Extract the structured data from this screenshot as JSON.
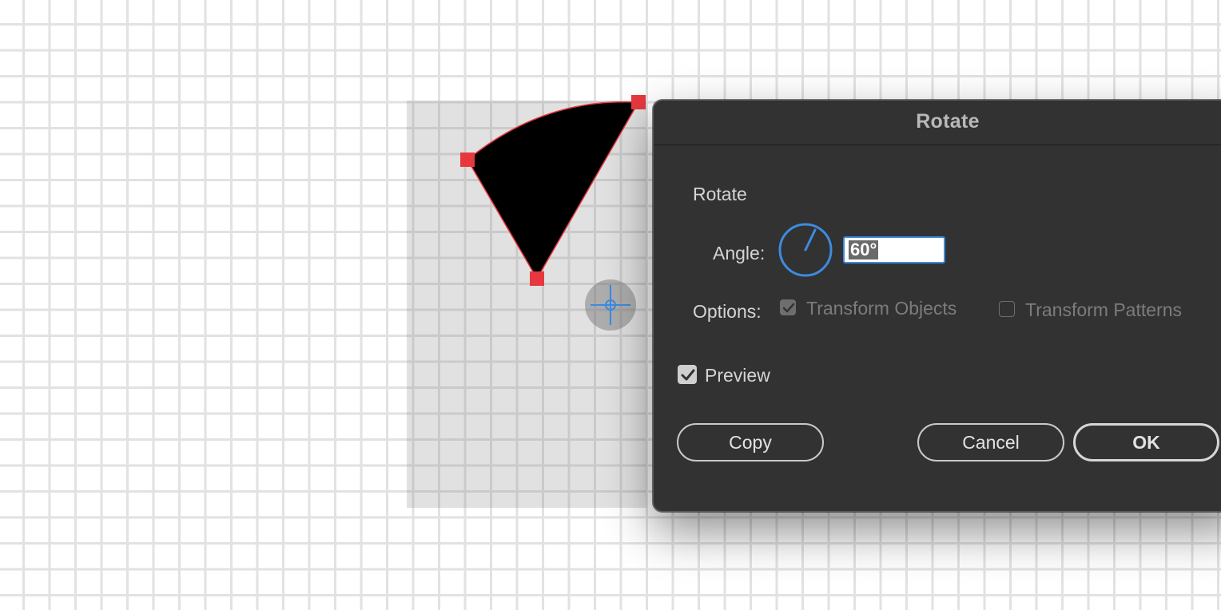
{
  "dialog": {
    "title": "Rotate",
    "section_label": "Rotate",
    "angle_label": "Angle:",
    "angle_value": "60°",
    "options_label": "Options:",
    "transform_objects_label": "Transform Objects",
    "transform_objects_checked": true,
    "transform_patterns_label": "Transform Patterns",
    "transform_patterns_checked": false,
    "preview_label": "Preview",
    "preview_checked": true,
    "buttons": {
      "copy": "Copy",
      "cancel": "Cancel",
      "ok": "OK"
    }
  },
  "colors": {
    "accent": "#3d8be0",
    "anchor": "#e8383f",
    "dialog_bg": "#323232"
  }
}
